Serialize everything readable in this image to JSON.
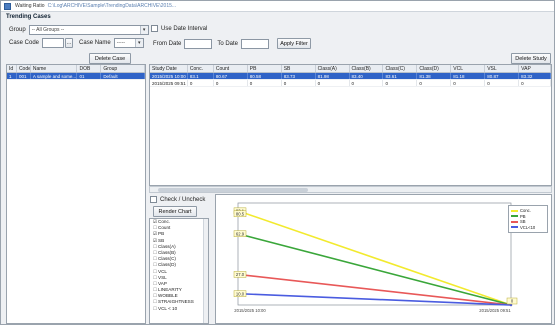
{
  "window": {
    "title": "Waiting Ratio",
    "file_path": "C:\\Log\\ARCHIVE\\Sample\\TrendingData\\ARCHIVE\\2015..."
  },
  "trending": {
    "section_label": "Trending Cases",
    "group_label": "Group",
    "group_value": "-- All Groups --",
    "use_date_interval_label": "Use Date Interval",
    "case_code_label": "Case Code",
    "case_name_label": "Case Name",
    "case_name_value": "-----",
    "from_date_label": "From Date",
    "to_date_label": "To Date",
    "apply_filter_label": "Apply Filter",
    "delete_case_label": "Delete Case",
    "delete_study_label": "Delete Study"
  },
  "cases_table": {
    "columns": [
      "Id",
      "Code",
      "Name",
      "DOB",
      "Group"
    ],
    "rows": [
      [
        "1",
        "001",
        "A sample and some...",
        "01",
        "Default"
      ]
    ]
  },
  "studies_table": {
    "columns": [
      "Study Date",
      "Conc.",
      "Count",
      "PB",
      "SB",
      "Class(A)",
      "Class(B)",
      "Class(C)",
      "Class(D)",
      "VCL",
      "VSL",
      "VAP"
    ],
    "rows": [
      [
        "2015/2025 10:00",
        "83.1",
        "80.67",
        "80.58",
        "83.73",
        "81.98",
        "83.40",
        "83.61",
        "81.38",
        "81.18",
        "80.87",
        "83.32"
      ],
      [
        "2015/2025 09:51",
        "0",
        "0",
        "0",
        "0",
        "0",
        "0",
        "0",
        "0",
        "0",
        "0",
        "0"
      ]
    ]
  },
  "chart_panel": {
    "check_uncheck_label": "Check / Uncheck",
    "render_chart_label": "Render Chart",
    "series_options": [
      {
        "label": "Conc.",
        "checked": true
      },
      {
        "label": "Count",
        "checked": false
      },
      {
        "label": "PB",
        "checked": true
      },
      {
        "label": "SB",
        "checked": true
      },
      {
        "label": "Class(A)",
        "checked": false
      },
      {
        "label": "Class(B)",
        "checked": false
      },
      {
        "label": "Class(C)",
        "checked": false
      },
      {
        "label": "Class(D)",
        "checked": false
      },
      {
        "label": "VCL",
        "checked": false
      },
      {
        "label": "VSL",
        "checked": false
      },
      {
        "label": "VAP",
        "checked": false
      },
      {
        "label": "LINEARITY",
        "checked": false
      },
      {
        "label": "WOBBLE",
        "checked": false
      },
      {
        "label": "STRAIGHTNESS",
        "checked": false
      },
      {
        "label": "VCL < 10",
        "checked": false
      }
    ]
  },
  "chart_data": {
    "type": "line",
    "x": [
      "2015/2025 10:00",
      "2015/2025 09:51"
    ],
    "series": [
      {
        "name": "Conc.",
        "color": "#f2ea2e",
        "values": [
          83.1,
          0
        ]
      },
      {
        "name": "PB",
        "color": "#3aa63a",
        "values": [
          62.9,
          0
        ]
      },
      {
        "name": "SB",
        "color": "#e85858",
        "values": [
          27.0,
          0
        ]
      },
      {
        "name": "VCL<10",
        "color": "#4a5ce0",
        "values": [
          10.0,
          0
        ]
      }
    ],
    "point_labels": [
      "83.1",
      "80.5",
      "62.9",
      "27.0",
      "10.0",
      "0"
    ],
    "ylim": [
      0,
      90
    ],
    "legend_position": "top-right",
    "grid": false
  },
  "colors": {
    "selection": "#2f63c7",
    "accent": "#4a7cc0"
  }
}
